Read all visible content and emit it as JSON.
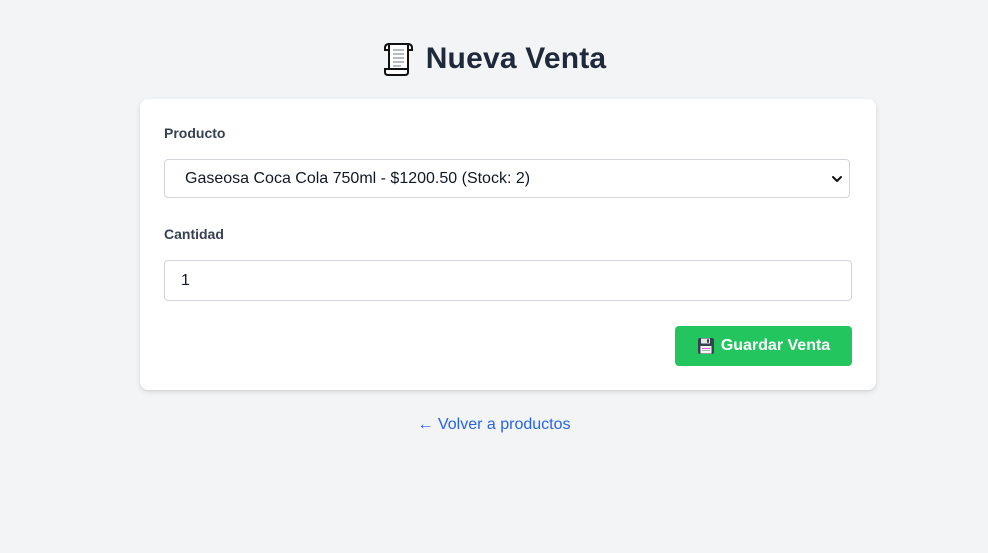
{
  "header": {
    "icon": "scroll-icon",
    "title": "Nueva Venta"
  },
  "form": {
    "product_label": "Producto",
    "product_selected": "Gaseosa Coca Cola 750ml - $1200.50 (Stock: 2)",
    "quantity_label": "Cantidad",
    "quantity_value": "1",
    "save_button": {
      "icon": "floppy-disk-icon",
      "label": "Guardar Venta",
      "color": "#22c55e"
    }
  },
  "footer": {
    "back_link": "← Volver a productos",
    "link_color": "#2563eb"
  }
}
